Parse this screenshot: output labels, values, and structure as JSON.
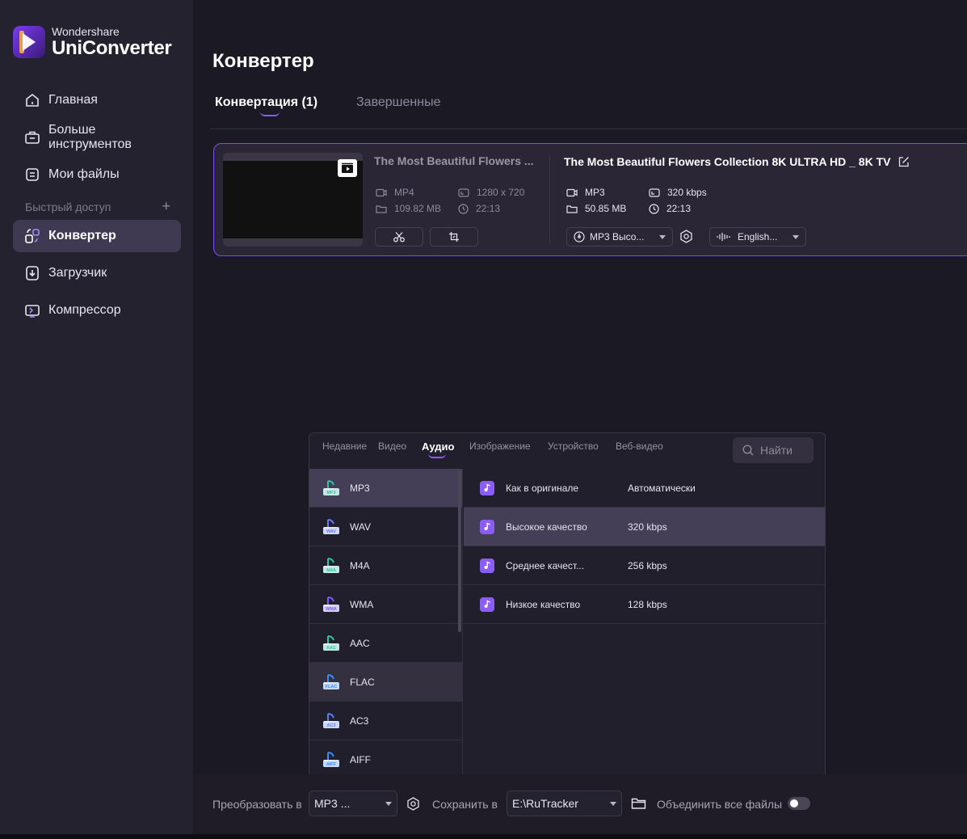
{
  "app": {
    "brand_small": "Wondershare",
    "brand_big": "UniConverter"
  },
  "sidebar": {
    "items": [
      {
        "label": "Главная",
        "icon": "home-icon"
      },
      {
        "label": "Больше инструментов",
        "icon": "toolbox-icon"
      },
      {
        "label": "Мои файлы",
        "icon": "files-icon"
      },
      {
        "label": "Конвертер",
        "icon": "converter-icon",
        "active": true
      },
      {
        "label": "Загрузчик",
        "icon": "download-icon"
      },
      {
        "label": "Компрессор",
        "icon": "compress-icon"
      }
    ],
    "quick_access": "Быстрый доступ",
    "quick_plus": "+"
  },
  "main": {
    "title": "Конвертер",
    "tabs": [
      {
        "label": "Конвертация (1)",
        "active": true
      },
      {
        "label": "Завершенные"
      }
    ]
  },
  "file": {
    "source_title": "The Most Beautiful Flowers ...",
    "source_format": "MP4",
    "source_size": "109.82 MB",
    "source_resolution": "1280 x 720",
    "source_duration": "22:13",
    "target_title": "The Most Beautiful Flowers Collection 8K ULTRA HD _ 8K TV",
    "target_format": "MP3",
    "target_size": "50.85 MB",
    "target_bitrate": "320 kbps",
    "target_duration": "22:13",
    "format_select": "MP3 Высо...",
    "audio_select": "English..."
  },
  "popup": {
    "tabs": [
      "Недавние",
      "Видео",
      "Аудио",
      "Изображение",
      "Устройство",
      "Веб-видео"
    ],
    "active_tab": "Аудио",
    "search_placeholder": "Найти",
    "formats": [
      {
        "name": "MP3",
        "badge": "MP3",
        "color": "#2fc4a4"
      },
      {
        "name": "WAV",
        "badge": "WAV",
        "color": "#6a7cf5"
      },
      {
        "name": "M4A",
        "badge": "M4A",
        "color": "#2fc4a4"
      },
      {
        "name": "WMA",
        "badge": "WMA",
        "color": "#7a5cf5"
      },
      {
        "name": "AAC",
        "badge": "AAC",
        "color": "#2fc4a4"
      },
      {
        "name": "FLAC",
        "badge": "FLAC",
        "color": "#3a8cf5"
      },
      {
        "name": "AC3",
        "badge": "AC3",
        "color": "#5a7cf5"
      },
      {
        "name": "AIFF",
        "badge": "AIFF",
        "color": "#3a8cf5"
      }
    ],
    "qualities": [
      {
        "name": "Как в оригинале",
        "value": "Автоматически"
      },
      {
        "name": "Высокое качество",
        "value": "320 kbps"
      },
      {
        "name": "Среднее качест...",
        "value": "256 kbps"
      },
      {
        "name": "Низкое качество",
        "value": "128 kbps"
      }
    ]
  },
  "bottom": {
    "convert_label": "Преобразовать в",
    "convert_value": "MP3 ...",
    "save_label": "Сохранить в",
    "save_value": "E:\\RuTracker",
    "merge_label": "Объединить все файлы"
  },
  "colors": {
    "accent": "#7c4cf4",
    "sidebar_bg": "#25222f",
    "main_bg": "#1b1924",
    "selected_row": "#443f56"
  }
}
